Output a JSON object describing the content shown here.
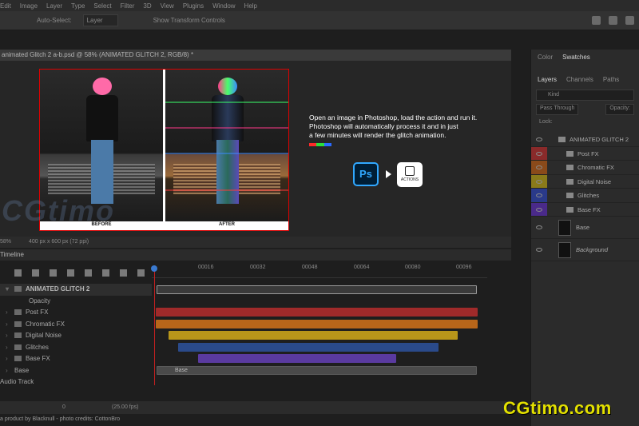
{
  "menubar": [
    "Edit",
    "Image",
    "Layer",
    "Type",
    "Select",
    "Filter",
    "3D",
    "View",
    "Plugins",
    "Window",
    "Help"
  ],
  "options": {
    "auto_select": "Auto-Select:",
    "auto_select_value": "Layer",
    "show_transform": "Show Transform Controls"
  },
  "document_tab": "animated Glitch 2 a-b.psd @ 58% (ANIMATED GLITCH 2, RGB/8) *",
  "promo": {
    "line1": "Open an image in Photoshop, load the action and run it.",
    "line2": "Photoshop will automatically process it and in just",
    "line3": "a few minutes will render the glitch animation.",
    "ps_icon": "Ps",
    "actions_label": "ACTIONS",
    "colorbar": [
      "#ff2a2a",
      "#2adf3a",
      "#2a6aff"
    ]
  },
  "captions": {
    "before": "BEFORE",
    "after": "AFTER"
  },
  "watermark_left": "CGtimo",
  "status": {
    "zoom": "58%",
    "doc_size": "400 px x 600 px (72 ppi)"
  },
  "timeline": {
    "title": "Timeline",
    "ticks": [
      "00016",
      "00032",
      "00048",
      "00064",
      "00080",
      "00096"
    ],
    "tracks": [
      {
        "name": "ANIMATED GLITCH 2",
        "kind": "group"
      },
      {
        "name": "Opacity",
        "kind": "prop"
      },
      {
        "name": "Post FX",
        "kind": "sub"
      },
      {
        "name": "Chromatic FX",
        "kind": "sub"
      },
      {
        "name": "Digital Noise",
        "kind": "sub"
      },
      {
        "name": "Glitches",
        "kind": "sub"
      },
      {
        "name": "Base FX",
        "kind": "sub"
      },
      {
        "name": "Base",
        "kind": "layer"
      },
      {
        "name": "Audio Track",
        "kind": "audio"
      }
    ],
    "base_bar_label": "Base",
    "frame": "0",
    "fps": "(25.00 fps)"
  },
  "footnote": "a product by Blacknull - photo credits: CottonBro",
  "panel": {
    "top_tabs": [
      "Color",
      "Swatches"
    ],
    "tabs": [
      "Layers",
      "Channels",
      "Paths"
    ],
    "search": "Kind",
    "blend": "Pass Through",
    "opacity_label": "Opacity:",
    "lock_label": "Lock:",
    "layers": [
      {
        "name": "ANIMATED GLITCH 2",
        "color": "",
        "kind": "group"
      },
      {
        "name": "Post FX",
        "color": "#8a2a2a",
        "kind": "folder"
      },
      {
        "name": "Chromatic FX",
        "color": "#8a4a1a",
        "kind": "folder"
      },
      {
        "name": "Digital Noise",
        "color": "#8a7a1a",
        "kind": "folder"
      },
      {
        "name": "Glitches",
        "color": "#2a3a8a",
        "kind": "folder"
      },
      {
        "name": "Base FX",
        "color": "#4a2a8a",
        "kind": "folder"
      },
      {
        "name": "Base",
        "color": "",
        "kind": "image"
      },
      {
        "name": "Background",
        "color": "",
        "kind": "image"
      }
    ]
  },
  "brand_logo": "CGtimo.com",
  "bar_colors": {
    "post_fx": "#a02a2a",
    "chromatic_fx": "#b8661a",
    "digital_noise": "#b8961a",
    "glitches": "#2a4a8a",
    "base_fx": "#5a3aa0"
  }
}
